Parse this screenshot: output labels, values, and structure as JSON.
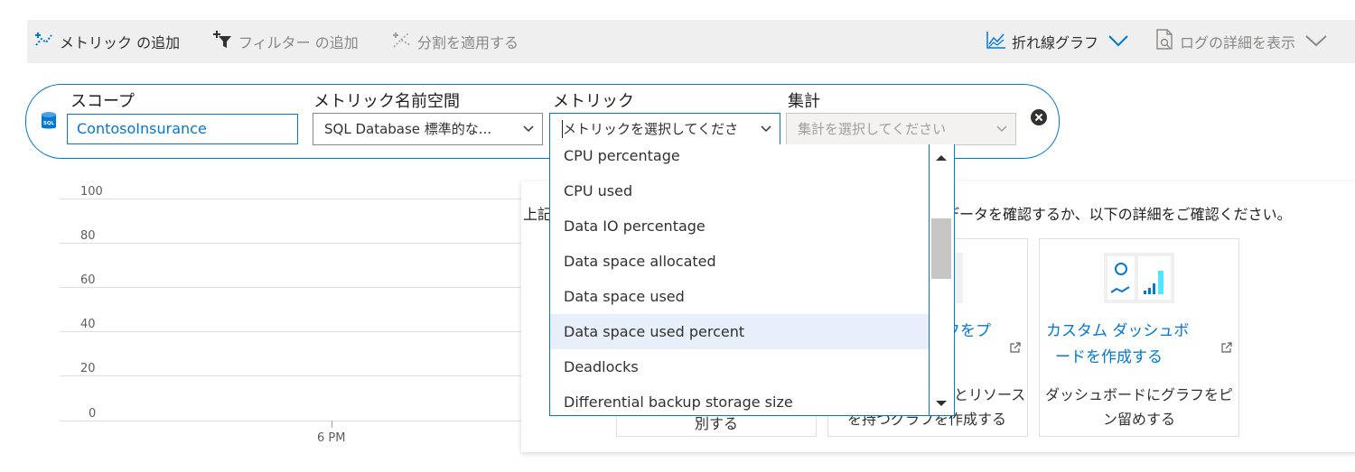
{
  "toolbar": {
    "add_metric": "メトリック の追加",
    "add_filter": "フィルター の追加",
    "apply_split": "分割を適用する",
    "line_chart": "折れ線グラフ",
    "view_logs": "ログの詳細を表示"
  },
  "scope": {
    "label": "スコープ",
    "value": "ContosoInsurance",
    "icon_text": "SQL"
  },
  "namespace": {
    "label": "メトリック名前空間",
    "value": "SQL Database 標準的な..."
  },
  "metric": {
    "label": "メトリック",
    "placeholder": "メトリックを選択してくださ",
    "options": [
      "CPU percentage",
      "CPU used",
      "Data IO percentage",
      "Data space allocated",
      "Data space used",
      "Data space used percent",
      "Deadlocks",
      "Differential backup storage size"
    ],
    "highlighted": "Data space used percent"
  },
  "aggregation": {
    "label": "集計",
    "placeholder": "集計を選択してください"
  },
  "chart": {
    "y_ticks": [
      "100",
      "80",
      "60",
      "40",
      "20",
      "0"
    ],
    "x_ticks": [
      "6 PM"
    ]
  },
  "empty_state": {
    "message_left": "上記",
    "message_right": "データを確認するか、以下の詳細をご確認ください。",
    "card1_desc": "別する",
    "card2_link": "フをプ",
    "card2_desc_1": "とリソース",
    "card2_desc_2": "を持つグラフを作成する",
    "card3_link_1": "カスタム ダッシュボ",
    "card3_link_2": "ードを作成する",
    "card3_desc_1": "ダッシュボードにグラフをピ",
    "card3_desc_2": "ン留めする"
  },
  "colors": {
    "accent": "#0078d4",
    "toolbar_bg": "#efefef",
    "highlight": "#e8eefa"
  }
}
